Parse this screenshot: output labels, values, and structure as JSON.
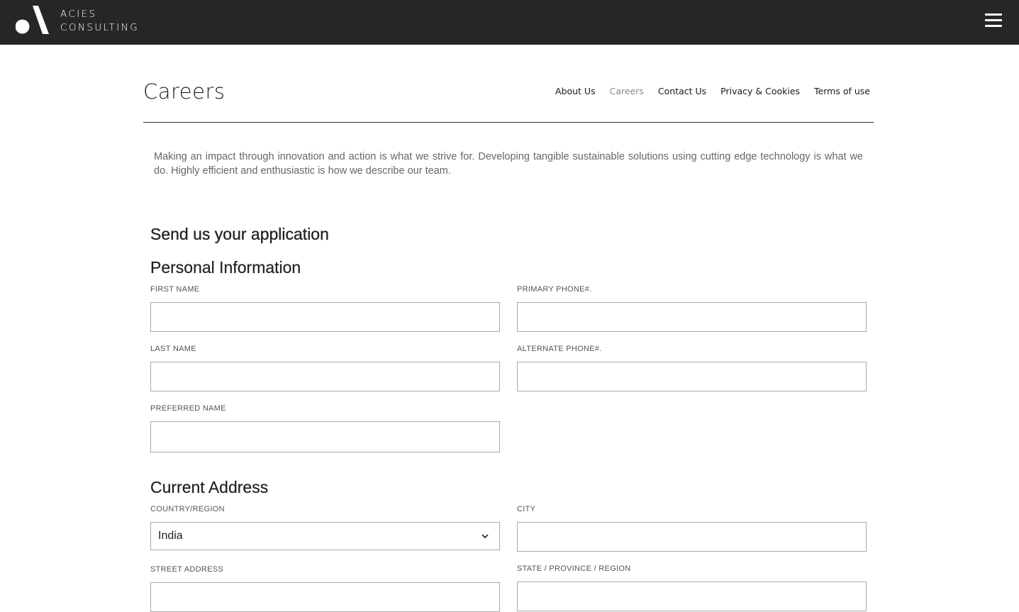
{
  "header": {
    "brand_line1": "ACIES",
    "brand_line2": "CONSULTING",
    "menu_icon": "hamburger-menu-icon"
  },
  "page": {
    "title": "Careers",
    "intro": "Making an impact through innovation and action is what we strive for. Developing tangible sustainable solutions using cutting edge technology is what we do. Highly efficient and enthusiastic is how we describe our team."
  },
  "subnav": {
    "items": [
      {
        "label": "About Us",
        "active": false
      },
      {
        "label": "Careers",
        "active": true
      },
      {
        "label": "Contact Us",
        "active": false
      },
      {
        "label": "Privacy & Cookies",
        "active": false
      },
      {
        "label": "Terms of use",
        "active": false
      }
    ]
  },
  "form": {
    "heading": "Send us your application",
    "personal": {
      "heading": "Personal Information",
      "first_name_label": "FIRST NAME",
      "first_name_value": "",
      "last_name_label": "LAST NAME",
      "last_name_value": "",
      "preferred_name_label": "PREFERRED NAME",
      "preferred_name_value": "",
      "primary_phone_label": "PRIMARY PHONE#.",
      "primary_phone_value": "",
      "alternate_phone_label": "ALTERNATE PHONE#.",
      "alternate_phone_value": ""
    },
    "address": {
      "heading": "Current Address",
      "country_label": "COUNTRY/REGION",
      "country_value": "India",
      "city_label": "CITY",
      "city_value": "",
      "street_label": "STREET ADDRESS",
      "street_value": "",
      "state_label": "STATE / PROVINCE / REGION",
      "state_value": ""
    }
  },
  "colors": {
    "topbar": "#262626",
    "active_nav": "#888888",
    "intro_text": "#666666",
    "input_border": "#a9a9a9"
  }
}
